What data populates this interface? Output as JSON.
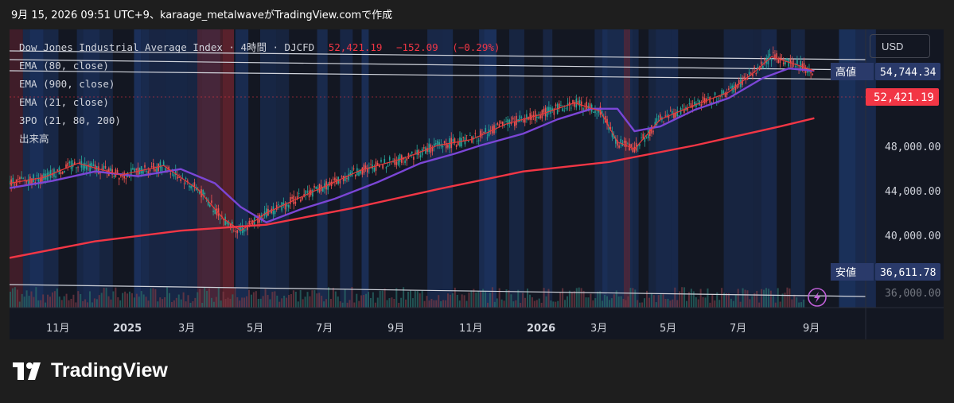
{
  "header": {
    "text": "9月 15, 2026 09:51 UTC+9、karaage_metalwaveがTradingView.comで作成"
  },
  "legend": {
    "title": "Dow Jones Industrial Average Index · 4時間 · DJCFD",
    "price": "52,421.19",
    "change": "−152.09",
    "change_pct": "(−0.29%)",
    "lines": [
      "EMA (80, close)",
      "EMA (900, close)",
      "EMA (21, close)",
      "3PO (21, 80, 200)",
      "出来高"
    ]
  },
  "currency": "USD",
  "price_labels": {
    "high_label": "高値",
    "high_value": "54,744.34",
    "low_label": "安値",
    "low_value": "36,611.78",
    "last_value": "52,421.19"
  },
  "footer": {
    "brand": "TradingView"
  },
  "colors": {
    "bg": "#131722",
    "ema80": "#7b46d6",
    "ema900": "#f23645",
    "ema21": "#e83a3a",
    "band_blue": "#1f3b73",
    "band_red": "#6b2430",
    "label_box": "#2a3a6a",
    "last_price": "#f23645"
  },
  "chart_data": {
    "type": "line",
    "title": "Dow Jones Industrial Average Index · 4時間 · DJCFD",
    "x_ticks": [
      "11月",
      "2025",
      "3月",
      "5月",
      "7月",
      "9月",
      "11月",
      "2026",
      "3月",
      "5月",
      "7月",
      "9月"
    ],
    "y_ticks": [
      "48,000.00",
      "44,000.00",
      "40,000.00"
    ],
    "ylim": [
      33000,
      56500
    ],
    "series": [
      {
        "name": "EMA (80, close)",
        "points": [
          [
            0,
            43100
          ],
          [
            0.05,
            43700
          ],
          [
            0.1,
            44500
          ],
          [
            0.15,
            44100
          ],
          [
            0.2,
            44700
          ],
          [
            0.24,
            43500
          ],
          [
            0.27,
            41500
          ],
          [
            0.3,
            40200
          ],
          [
            0.34,
            41300
          ],
          [
            0.38,
            42200
          ],
          [
            0.43,
            43600
          ],
          [
            0.48,
            45200
          ],
          [
            0.52,
            46000
          ],
          [
            0.55,
            46700
          ],
          [
            0.6,
            47700
          ],
          [
            0.64,
            48900
          ],
          [
            0.68,
            49800
          ],
          [
            0.71,
            49800
          ],
          [
            0.73,
            47900
          ],
          [
            0.76,
            48300
          ],
          [
            0.8,
            49700
          ],
          [
            0.84,
            50700
          ],
          [
            0.88,
            52400
          ],
          [
            0.91,
            53200
          ],
          [
            0.94,
            53000
          ]
        ]
      },
      {
        "name": "EMA (21, close)",
        "points": [
          [
            0,
            43500
          ],
          [
            0.04,
            44000
          ],
          [
            0.08,
            45200
          ],
          [
            0.13,
            44200
          ],
          [
            0.18,
            45000
          ],
          [
            0.22,
            43000
          ],
          [
            0.25,
            40500
          ],
          [
            0.27,
            39500
          ],
          [
            0.3,
            41000
          ],
          [
            0.33,
            42000
          ],
          [
            0.37,
            43300
          ],
          [
            0.41,
            44600
          ],
          [
            0.46,
            45600
          ],
          [
            0.5,
            46700
          ],
          [
            0.54,
            47200
          ],
          [
            0.58,
            48500
          ],
          [
            0.62,
            49300
          ],
          [
            0.66,
            50300
          ],
          [
            0.69,
            49600
          ],
          [
            0.71,
            47000
          ],
          [
            0.73,
            46400
          ],
          [
            0.76,
            48900
          ],
          [
            0.8,
            50100
          ],
          [
            0.84,
            51200
          ],
          [
            0.87,
            52900
          ],
          [
            0.89,
            54200
          ],
          [
            0.92,
            53500
          ],
          [
            0.94,
            53000
          ]
        ]
      },
      {
        "name": "EMA (900, close)",
        "points": [
          [
            0,
            37200
          ],
          [
            0.1,
            38600
          ],
          [
            0.2,
            39500
          ],
          [
            0.3,
            40000
          ],
          [
            0.4,
            41400
          ],
          [
            0.5,
            43000
          ],
          [
            0.6,
            44500
          ],
          [
            0.7,
            45300
          ],
          [
            0.8,
            46700
          ],
          [
            0.9,
            48300
          ],
          [
            0.94,
            49000
          ]
        ]
      }
    ]
  }
}
